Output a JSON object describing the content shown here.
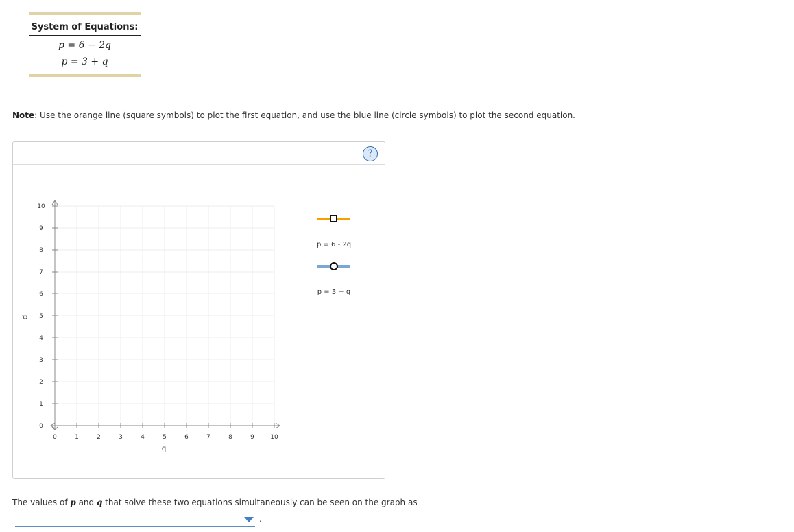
{
  "equations": {
    "title": "System of Equations:",
    "eq1": "p = 6 − 2q",
    "eq2": "p = 3 + q"
  },
  "note": {
    "label": "Note",
    "text": ": Use the orange line (square symbols) to plot the first equation, and use the blue line (circle symbols) to plot the second equation."
  },
  "help": {
    "symbol": "?"
  },
  "graph": {
    "x_axis_label": "q",
    "y_axis_label": "p",
    "x_ticks": [
      "0",
      "1",
      "2",
      "3",
      "4",
      "5",
      "6",
      "7",
      "8",
      "9",
      "10"
    ],
    "y_ticks": [
      "0",
      "1",
      "2",
      "3",
      "4",
      "5",
      "6",
      "7",
      "8",
      "9",
      "10"
    ],
    "xlim": [
      0,
      10
    ],
    "ylim": [
      0,
      10
    ],
    "grid": true
  },
  "legend": {
    "series1": {
      "label": "p = 6 - 2q",
      "color": "#f59f00",
      "marker": "square"
    },
    "series2": {
      "label": "p = 3 + q",
      "color": "#7aa7d4",
      "marker": "circle"
    }
  },
  "answer": {
    "part1": "The values of ",
    "var_p": "p",
    "part2": " and ",
    "var_q": "q",
    "part3": " that solve these two equations simultaneously can be seen on the graph as",
    "dropdown_value": "",
    "suffix": "."
  }
}
